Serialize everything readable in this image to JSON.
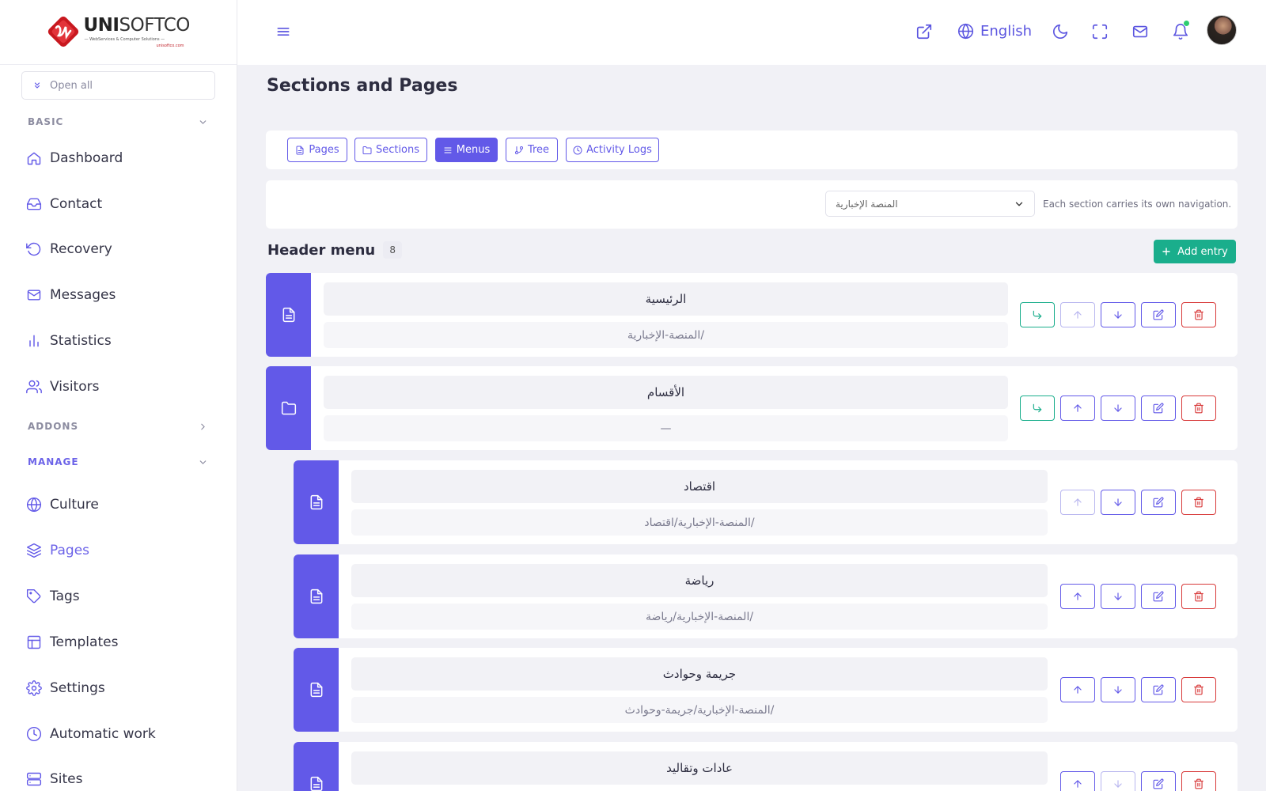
{
  "brand": {
    "name_bold": "UNI",
    "name_light": "SOFTCO",
    "tagline": "— WebServices & Computer Solutions —",
    "url": "unisoftco.com"
  },
  "sidebar": {
    "open_all": "Open all",
    "groups": [
      {
        "label": "BASIC",
        "color": "#8c8ca0",
        "state": "expanded"
      },
      {
        "label": "ADDONS",
        "color": "#8c8ca0",
        "state": "collapsed"
      },
      {
        "label": "MANAGE",
        "color": "#6c63e8",
        "state": "expanded"
      }
    ],
    "items": [
      {
        "label": "Dashboard",
        "icon": "home-icon"
      },
      {
        "label": "Contact",
        "icon": "inbox-icon"
      },
      {
        "label": "Recovery",
        "icon": "rotate-ccw-icon"
      },
      {
        "label": "Messages",
        "icon": "mail-icon"
      },
      {
        "label": "Statistics",
        "icon": "bar-chart-icon"
      },
      {
        "label": "Visitors",
        "icon": "users-icon"
      },
      {
        "label": "Culture",
        "icon": "globe-icon"
      },
      {
        "label": "Pages",
        "icon": "layers-icon",
        "active": true
      },
      {
        "label": "Tags",
        "icon": "tag-icon"
      },
      {
        "label": "Templates",
        "icon": "layout-icon"
      },
      {
        "label": "Settings",
        "icon": "settings-icon"
      },
      {
        "label": "Automatic work",
        "icon": "clock-icon"
      },
      {
        "label": "Sites",
        "icon": "server-icon"
      }
    ]
  },
  "topbar": {
    "language": "English",
    "icons": [
      "menu-icon",
      "external-link-icon",
      "globe-icon",
      "moon-icon",
      "maximize-icon",
      "mail-icon",
      "bell-icon",
      "avatar"
    ]
  },
  "page": {
    "title": "Sections and Pages"
  },
  "tabs": [
    {
      "label": "Pages",
      "icon": "file-icon"
    },
    {
      "label": "Sections",
      "icon": "folder-icon"
    },
    {
      "label": "Menus",
      "icon": "list-icon",
      "active": true
    },
    {
      "label": "Tree",
      "icon": "git-branch-icon"
    },
    {
      "label": "Activity Logs",
      "icon": "clock-icon"
    }
  ],
  "filter": {
    "selected": "المنصة الإخبارية",
    "hint": "Each section carries its own navigation."
  },
  "menu": {
    "title": "Header menu",
    "count": "8",
    "add_label": "Add entry"
  },
  "entries": [
    {
      "name": "الرئيسية",
      "url": "/المنصة-الإخبارية",
      "type": "page",
      "level": 0,
      "indent": true,
      "up_disabled": true,
      "down_disabled": false
    },
    {
      "name": "الأقسام",
      "url": "—",
      "type": "folder",
      "level": 0,
      "indent": true,
      "up_disabled": false,
      "down_disabled": false
    },
    {
      "name": "اقتصاد",
      "url": "/المنصة-الإخبارية/اقتصاد",
      "type": "page",
      "level": 1,
      "indent": false,
      "up_disabled": true,
      "down_disabled": false
    },
    {
      "name": "رياضة",
      "url": "/المنصة-الإخبارية/رياضة",
      "type": "page",
      "level": 1,
      "indent": false,
      "up_disabled": false,
      "down_disabled": false
    },
    {
      "name": "جريمة وحوادث",
      "url": "/المنصة-الإخبارية/جريمة-وحوادث",
      "type": "page",
      "level": 1,
      "indent": false,
      "up_disabled": false,
      "down_disabled": false
    },
    {
      "name": "عادات وتقاليد",
      "url": "",
      "type": "page",
      "level": 1,
      "indent": false,
      "up_disabled": false,
      "down_disabled": true
    }
  ],
  "colors": {
    "primary": "#6259e8",
    "success": "#1aae8c",
    "danger": "#d83a3a",
    "background": "#f1f1f6"
  }
}
